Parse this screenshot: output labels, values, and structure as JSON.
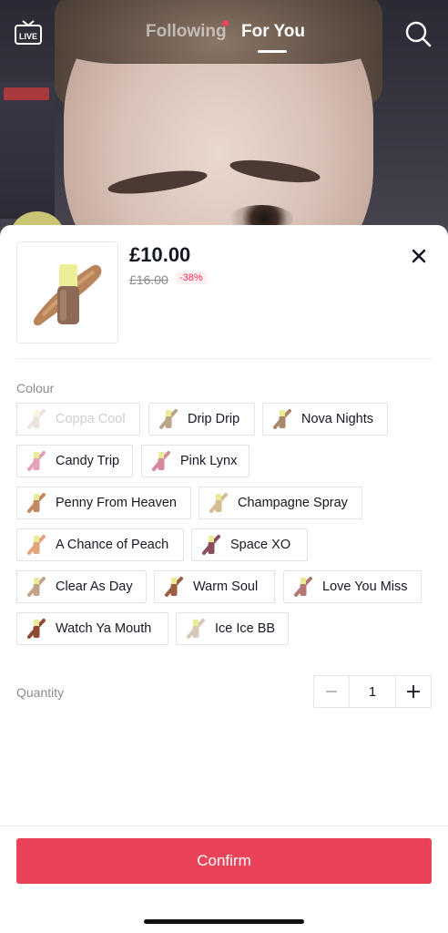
{
  "top_nav": {
    "live_label": "LIVE",
    "tabs": [
      {
        "label": "Following",
        "active": false,
        "has_dot": true
      },
      {
        "label": "For You",
        "active": true
      }
    ]
  },
  "product": {
    "price": "£10.00",
    "old_price": "£16.00",
    "discount": "-38%"
  },
  "colour": {
    "label": "Colour",
    "options": [
      {
        "label": "Coppa Cool",
        "available": false,
        "swatch_color": "#c9b7a4"
      },
      {
        "label": "Drip Drip",
        "available": true,
        "swatch_color": "#b9a58a"
      },
      {
        "label": "Nova Nights",
        "available": true,
        "swatch_color": "#a8876a"
      },
      {
        "label": "Candy Trip",
        "available": true,
        "swatch_color": "#e5a2b8"
      },
      {
        "label": "Pink Lynx",
        "available": true,
        "swatch_color": "#d8899b"
      },
      {
        "label": "Penny From Heaven",
        "available": true,
        "swatch_color": "#c28a63"
      },
      {
        "label": "Champagne Spray",
        "available": true,
        "swatch_color": "#d4bd92"
      },
      {
        "label": "A Chance of Peach",
        "available": true,
        "swatch_color": "#e4a27d"
      },
      {
        "label": "Space XO",
        "available": true,
        "swatch_color": "#8b4e5c"
      },
      {
        "label": "Clear As Day",
        "available": true,
        "swatch_color": "#c1a48c"
      },
      {
        "label": "Warm Soul",
        "available": true,
        "swatch_color": "#9b5d45"
      },
      {
        "label": "Love You Miss",
        "available": true,
        "swatch_color": "#b4766f"
      },
      {
        "label": "Watch Ya Mouth",
        "available": true,
        "swatch_color": "#8f4a35"
      },
      {
        "label": "Ice Ice BB",
        "available": true,
        "swatch_color": "#d7c9b9"
      }
    ]
  },
  "quantity": {
    "label": "Quantity",
    "value": "1"
  },
  "confirm_label": "Confirm",
  "colors": {
    "accent": "#ea4359",
    "discount": "#fe2c55"
  }
}
